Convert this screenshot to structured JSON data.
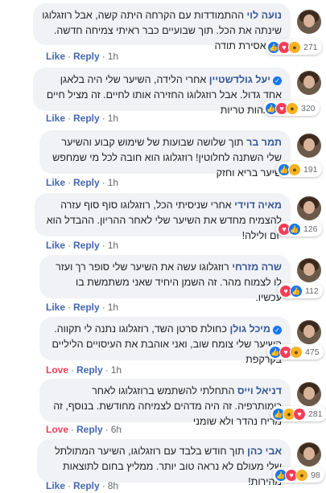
{
  "comments": [
    {
      "author": "נועה לוי",
      "verified": false,
      "text": "ההתמודדות עם הקרחה היתה קשה, אבל רוזגלוגו שינתה את הכל. תוך שבועיים כבר ראיתי צמיחה חדשה. אני אסירת תודה",
      "reactions": [
        "like",
        "love",
        "wow"
      ],
      "count": "271",
      "action": "Like",
      "reply": "Reply",
      "time": "1h"
    },
    {
      "author": "יעל גולדשטיין",
      "verified": true,
      "text": "אחרי הלידה, השיער שלי היה בלאגן אחד גדול. אבל רוזגלוגו החזירה אותו לחיים. זה מציל חיים לאמהות טריות",
      "reactions": [
        "like",
        "love",
        "wow"
      ],
      "count": "320",
      "action": "Like",
      "reply": "Reply",
      "time": "1h"
    },
    {
      "author": "תמר בר",
      "verified": false,
      "text": "תוך שלושה שבועות של שימוש קבוע והשיער שלי השתנה לחלוטין! רוזגלוגו הוא חובה לכל מי שמחפש שיער בריא וחזק",
      "reactions": [
        "like",
        "wow"
      ],
      "count": "191",
      "action": "Like",
      "reply": "Reply",
      "time": "1h"
    },
    {
      "author": "מאיה דוידי",
      "verified": false,
      "text": "אחרי שניסיתי הכל, רוזגלוגו סוף סוף עזרה להצמיח מחדש את השיער שלי לאחר ההריון. ההבדל הוא יום ולילה!",
      "reactions": [
        "love",
        "like"
      ],
      "count": "126",
      "action": "Like",
      "reply": "Reply",
      "time": "1h"
    },
    {
      "author": "שרה מזרחי",
      "verified": false,
      "text": "רוזגלוגו עשה את השיער שלי סופר רך ועזר לו לצמוח מהר. זה השמן היחיד שאני משתמשת בו עכשיו.",
      "reactions": [
        "love",
        "like"
      ],
      "count": "112",
      "action": "Like",
      "reply": "Reply",
      "time": "1h"
    },
    {
      "author": "מיכל גולן",
      "verified": true,
      "text": "כחולת סרטן השד, רוזגלוגו נתנה לי תקווה. השיער שלי צומח שוב, ואני אוהבת את העיסויים הליליים בקרקפת",
      "reactions": [
        "like",
        "love",
        "wow"
      ],
      "count": "475",
      "action": "Love",
      "reply": "Reply",
      "time": "1h"
    },
    {
      "author": "דניאל וייס",
      "verified": false,
      "text": "התחלתי להשתמש ברוזגלוגו לאחר כימותרפיה. זה היה מדהים לצמיחה מחודשת. בנוסף, זה מריח נהדר ולא שומני",
      "reactions": [
        "like",
        "wow",
        "love"
      ],
      "count": "281",
      "action": "Love",
      "reply": "Reply",
      "time": "6h"
    },
    {
      "author": "אבי כהן",
      "verified": false,
      "text": "תוך חודש בלבד עם רוזגלוגו, השיער המתולתל שלי מעולם לא נראה טוב יותר. ממליץ בחום לתוצאות מהירות!",
      "reactions": [
        "like",
        "love",
        "wow"
      ],
      "count": "98",
      "action": "Like",
      "reply": "Reply",
      "time": "8h"
    }
  ]
}
